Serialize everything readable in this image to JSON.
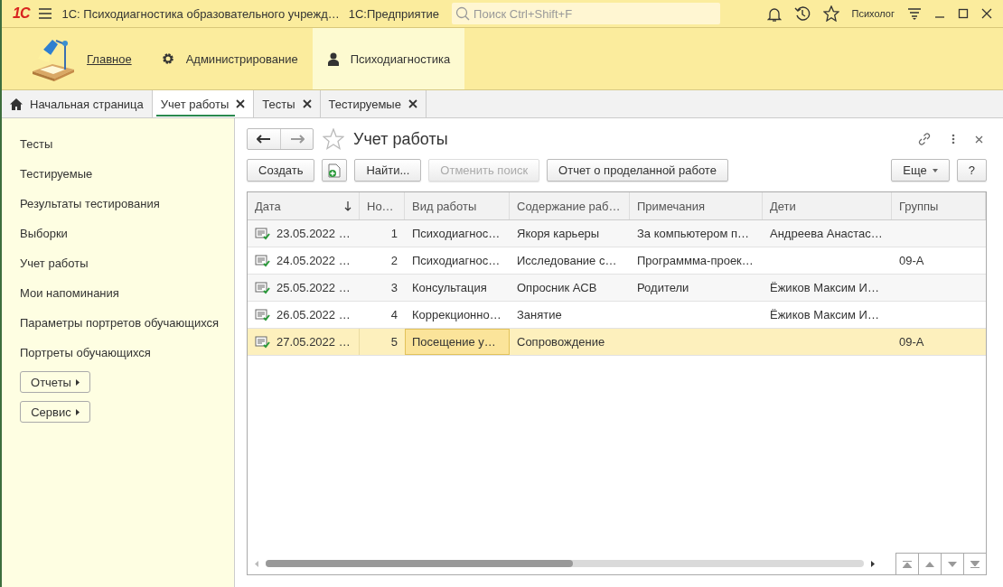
{
  "titlebar": {
    "logo": "1С",
    "title": "1С: Психодиагностика образовательного учрежд…",
    "app": "1С:Предприятие",
    "search": {
      "placeholder": "Поиск Ctrl+Shift+F"
    },
    "user": "Психолог"
  },
  "sections": [
    {
      "label": "Главное",
      "kind": "home",
      "selected": false
    },
    {
      "label": "Администрирование",
      "kind": "gear",
      "selected": false
    },
    {
      "label": "Психодиагностика",
      "kind": "person",
      "selected": true
    }
  ],
  "tabs": [
    {
      "label": "Начальная страница",
      "kind": "home",
      "selected": false
    },
    {
      "label": "Учет работы",
      "kind": "closable",
      "selected": true
    },
    {
      "label": "Тесты",
      "kind": "closable",
      "selected": false
    },
    {
      "label": "Тестируемые",
      "kind": "closable",
      "selected": false
    }
  ],
  "sidebar": {
    "items": [
      "Тесты",
      "Тестируемые",
      "Результаты тестирования",
      "Выборки",
      "Учет работы",
      "Мои напоминания",
      "Параметры портретов обучающихся",
      "Портреты обучающихся"
    ],
    "menus": [
      "Отчеты",
      "Сервис"
    ]
  },
  "form": {
    "title": "Учет работы",
    "toolbar": [
      {
        "label": "Создать",
        "kind": "text",
        "disabled": false
      },
      {
        "kind": "add-icon",
        "disabled": false
      },
      {
        "label": "Найти...",
        "kind": "text",
        "disabled": false
      },
      {
        "label": "Отменить поиск",
        "kind": "text",
        "disabled": true
      },
      {
        "label": "Отчет о проделанной работе",
        "kind": "text",
        "disabled": false
      }
    ],
    "more_button": "Еще",
    "help_button": "?",
    "table": {
      "columns": [
        {
          "label": "Дата",
          "sorted": true
        },
        {
          "label": "Но…",
          "sorted": false
        },
        {
          "label": "Вид работы",
          "sorted": false
        },
        {
          "label": "Содержание раб…",
          "sorted": false
        },
        {
          "label": "Примечания",
          "sorted": false
        },
        {
          "label": "Дети",
          "sorted": false
        },
        {
          "label": "Группы",
          "sorted": false
        }
      ],
      "rows": [
        {
          "selected": false,
          "cells": [
            {
              "text": "23.05.2022 …",
              "current": false
            },
            {
              "text": "1",
              "current": false
            },
            {
              "text": "Психодиагнос…",
              "current": false
            },
            {
              "text": "Якоря карьеры",
              "current": false
            },
            {
              "text": "За компьютером п…",
              "current": false
            },
            {
              "text": "Андреева Анастас…",
              "current": false
            },
            {
              "current": false
            }
          ]
        },
        {
          "selected": false,
          "cells": [
            {
              "text": "24.05.2022 …",
              "current": false
            },
            {
              "text": "2",
              "current": false
            },
            {
              "text": "Психодиагнос…",
              "current": false
            },
            {
              "text": "Исследование с…",
              "current": false
            },
            {
              "text": "Программма-проек…",
              "current": false
            },
            {
              "current": false
            },
            {
              "text": "09-А",
              "current": false
            }
          ]
        },
        {
          "selected": false,
          "cells": [
            {
              "text": "25.05.2022 …",
              "current": false
            },
            {
              "text": "3",
              "current": false
            },
            {
              "text": "Консультация",
              "current": false
            },
            {
              "text": "Опросник АСВ",
              "current": false
            },
            {
              "text": "Родители",
              "current": false
            },
            {
              "text": "Ёжиков Максим И…",
              "current": false
            },
            {
              "current": false
            }
          ]
        },
        {
          "selected": false,
          "cells": [
            {
              "text": "26.05.2022 …",
              "current": false
            },
            {
              "text": "4",
              "current": false
            },
            {
              "text": "Коррекционно…",
              "current": false
            },
            {
              "text": "Занятие",
              "current": false
            },
            {
              "current": false
            },
            {
              "text": "Ёжиков Максим И…",
              "current": false
            },
            {
              "current": false
            }
          ]
        },
        {
          "selected": true,
          "cells": [
            {
              "text": "27.05.2022 …",
              "current": false
            },
            {
              "text": "5",
              "current": false
            },
            {
              "text": "Посещение у…",
              "current": true
            },
            {
              "text": "Сопровождение",
              "current": false
            },
            {
              "current": false
            },
            {
              "current": false
            },
            {
              "text": "09-А",
              "current": false
            }
          ]
        }
      ]
    }
  }
}
